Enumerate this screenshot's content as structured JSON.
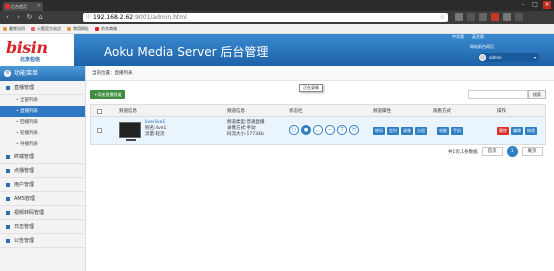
{
  "browser": {
    "tab_title": "后台首页",
    "url_host": "192.168.2.62",
    "url_path": ":9001/admin.html",
    "bookmarks": [
      "最常访问",
      "火狐官方站点",
      "常用网址",
      "京东商城"
    ]
  },
  "header": {
    "logo_text": "bisin",
    "logo_sub": "北京伯信",
    "app_title": "Aoku Media Server 后台管理",
    "lang_cn": "中文版",
    "lang_en": "英文版",
    "site_link": "网站前台网页",
    "username": "admin"
  },
  "sidebar": {
    "head": "功能菜单",
    "items": [
      {
        "label": "直播管理",
        "subs": [
          {
            "label": "全部列表"
          },
          {
            "label": "直播列表"
          },
          {
            "label": "回播列表"
          },
          {
            "label": "轮播列表"
          },
          {
            "label": "导播列表"
          }
        ]
      },
      {
        "label": "终端管理"
      },
      {
        "label": "点播管理"
      },
      {
        "label": "用户管理"
      },
      {
        "label": "AMS管理"
      },
      {
        "label": "视频转码管理"
      },
      {
        "label": "日志管理"
      },
      {
        "label": "公告管理"
      }
    ]
  },
  "main": {
    "breadcrumb": "当前位置：直播列表",
    "add_button": "+添加直播频道",
    "search_button": "搜索",
    "columns": [
      "频道信息",
      "频道信息",
      "状态栏",
      "频道属性",
      "观看方式",
      "操作"
    ],
    "row": {
      "name_link": "live/live1",
      "alias": "别名:live1",
      "flow": "流量:轻流",
      "type": "频道类型:普通直播",
      "record_mode": "录像方式:手动",
      "bitrate": "码流大小:17734b",
      "tooltip": "正在录像",
      "status_icons": [
        "ok",
        "rec",
        "more",
        "stop",
        "T",
        "H"
      ],
      "attr_buttons": [
        "转码",
        "定时",
        "录像",
        "分组"
      ],
      "watch_buttons": [
        "电脑",
        "手机"
      ],
      "op_buttons": [
        "删除",
        "编辑",
        "修改"
      ]
    },
    "pager": {
      "summary": "共1页,1条数据",
      "first": "首页",
      "current": "1",
      "last": "尾页"
    }
  }
}
